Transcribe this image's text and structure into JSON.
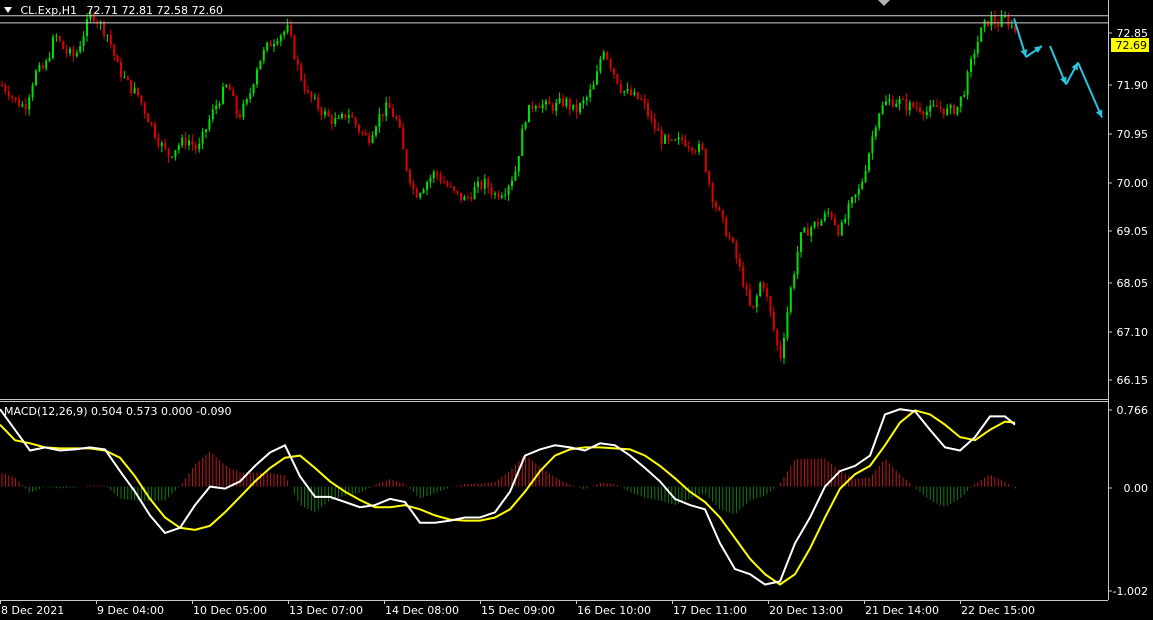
{
  "header": {
    "symbol": "CL.Exp,H1",
    "ohlc": "72.71 72.81 72.58 72.60"
  },
  "macd_header": "MACD(12,26,9) 0.504 0.573 0.000 -0.090",
  "price_badge": "72.69",
  "colors": {
    "background": "#000000",
    "bull_candle": "#00e000",
    "bear_candle": "#e00000",
    "macd_line": "#ffffff",
    "signal_line": "#ffff00",
    "forecast_arrows": "#29c6e0",
    "badge": "#ffff00"
  },
  "chart_data": [
    {
      "type": "candlestick",
      "title": "CL.Exp,H1",
      "ylim": [
        65.9,
        73.1
      ],
      "y_ticks": [
        "72.85",
        "72.69",
        "71.90",
        "70.95",
        "70.00",
        "69.05",
        "68.05",
        "67.10",
        "66.15"
      ],
      "x_ticks": [
        "8 Dec 2021",
        "9 Dec 04:00",
        "10 Dec 05:00",
        "13 Dec 07:00",
        "14 Dec 08:00",
        "15 Dec 09:00",
        "16 Dec 10:00",
        "17 Dec 11:00",
        "20 Dec 13:00",
        "21 Dec 14:00",
        "22 Dec 15:00"
      ],
      "horizontal_levels": [
        72.85,
        72.72
      ],
      "current_price": 72.69,
      "close_path": [
        [
          0,
          71.6
        ],
        [
          8,
          71.5
        ],
        [
          15,
          71.3
        ],
        [
          25,
          71.2
        ],
        [
          35,
          71.8
        ],
        [
          45,
          71.9
        ],
        [
          55,
          72.5
        ],
        [
          65,
          72.2
        ],
        [
          75,
          72.1
        ],
        [
          85,
          72.6
        ],
        [
          92,
          72.9
        ],
        [
          100,
          72.7
        ],
        [
          108,
          72.5
        ],
        [
          118,
          71.9
        ],
        [
          128,
          71.6
        ],
        [
          138,
          71.4
        ],
        [
          148,
          71.0
        ],
        [
          158,
          70.6
        ],
        [
          168,
          70.3
        ],
        [
          178,
          70.5
        ],
        [
          188,
          70.6
        ],
        [
          198,
          70.4
        ],
        [
          208,
          70.9
        ],
        [
          218,
          71.3
        ],
        [
          228,
          71.6
        ],
        [
          238,
          71.0
        ],
        [
          248,
          71.3
        ],
        [
          258,
          72.0
        ],
        [
          268,
          72.3
        ],
        [
          278,
          72.5
        ],
        [
          288,
          72.6
        ],
        [
          298,
          71.9
        ],
        [
          308,
          71.4
        ],
        [
          318,
          71.2
        ],
        [
          328,
          71.0
        ],
        [
          338,
          70.9
        ],
        [
          348,
          71.1
        ],
        [
          358,
          70.8
        ],
        [
          368,
          70.6
        ],
        [
          378,
          71.0
        ],
        [
          388,
          71.2
        ],
        [
          398,
          70.9
        ],
        [
          405,
          70.2
        ],
        [
          415,
          69.6
        ],
        [
          425,
          69.8
        ],
        [
          435,
          70.0
        ],
        [
          445,
          69.8
        ],
        [
          455,
          69.6
        ],
        [
          465,
          69.5
        ],
        [
          475,
          69.7
        ],
        [
          485,
          69.8
        ],
        [
          495,
          69.6
        ],
        [
          505,
          69.7
        ],
        [
          515,
          70.0
        ],
        [
          525,
          71.0
        ],
        [
          535,
          71.3
        ],
        [
          545,
          71.2
        ],
        [
          555,
          71.2
        ],
        [
          565,
          71.3
        ],
        [
          575,
          71.1
        ],
        [
          585,
          71.3
        ],
        [
          595,
          71.6
        ],
        [
          603,
          72.3
        ],
        [
          612,
          71.9
        ],
        [
          622,
          71.5
        ],
        [
          632,
          71.4
        ],
        [
          642,
          71.3
        ],
        [
          652,
          70.9
        ],
        [
          662,
          70.6
        ],
        [
          672,
          70.5
        ],
        [
          682,
          70.6
        ],
        [
          692,
          70.5
        ],
        [
          702,
          70.4
        ],
        [
          712,
          69.6
        ],
        [
          722,
          69.1
        ],
        [
          732,
          68.7
        ],
        [
          742,
          68.1
        ],
        [
          752,
          67.4
        ],
        [
          762,
          68.1
        ],
        [
          772,
          67.3
        ],
        [
          780,
          66.6
        ],
        [
          790,
          67.8
        ],
        [
          800,
          68.8
        ],
        [
          810,
          69.0
        ],
        [
          820,
          69.1
        ],
        [
          830,
          69.3
        ],
        [
          840,
          68.9
        ],
        [
          850,
          69.4
        ],
        [
          860,
          69.7
        ],
        [
          868,
          70.3
        ],
        [
          878,
          71.1
        ],
        [
          888,
          71.3
        ],
        [
          898,
          71.3
        ],
        [
          908,
          71.2
        ],
        [
          918,
          71.2
        ],
        [
          928,
          71.1
        ],
        [
          938,
          71.2
        ],
        [
          948,
          71.1
        ],
        [
          958,
          71.2
        ],
        [
          966,
          71.6
        ],
        [
          974,
          72.2
        ],
        [
          982,
          72.6
        ],
        [
          990,
          72.8
        ],
        [
          998,
          72.7
        ],
        [
          1006,
          72.8
        ],
        [
          1014,
          72.6
        ]
      ],
      "forecast_arrows": [
        [
          1014,
          72.8,
          1026,
          72.1
        ],
        [
          1026,
          72.1,
          1042,
          72.3
        ],
        [
          1050,
          72.3,
          1066,
          71.6
        ],
        [
          1066,
          71.6,
          1078,
          72.0
        ],
        [
          1078,
          72.0,
          1102,
          71.0
        ]
      ]
    },
    {
      "type": "line",
      "title": "MACD(12,26,9)",
      "ylim": [
        -1.1,
        0.82
      ],
      "y_ticks": [
        "0.766",
        "0.00",
        "-1.002"
      ],
      "series": [
        {
          "name": "MACD",
          "points": [
            [
              0,
              0.75
            ],
            [
              15,
              0.55
            ],
            [
              30,
              0.35
            ],
            [
              45,
              0.38
            ],
            [
              60,
              0.35
            ],
            [
              75,
              0.36
            ],
            [
              90,
              0.38
            ],
            [
              105,
              0.36
            ],
            [
              120,
              0.15
            ],
            [
              135,
              -0.05
            ],
            [
              150,
              -0.28
            ],
            [
              165,
              -0.45
            ],
            [
              180,
              -0.4
            ],
            [
              195,
              -0.18
            ],
            [
              210,
              0.0
            ],
            [
              225,
              -0.02
            ],
            [
              240,
              0.05
            ],
            [
              255,
              0.2
            ],
            [
              270,
              0.33
            ],
            [
              285,
              0.4
            ],
            [
              300,
              0.1
            ],
            [
              315,
              -0.1
            ],
            [
              330,
              -0.1
            ],
            [
              345,
              -0.15
            ],
            [
              360,
              -0.2
            ],
            [
              375,
              -0.18
            ],
            [
              390,
              -0.12
            ],
            [
              405,
              -0.15
            ],
            [
              420,
              -0.35
            ],
            [
              435,
              -0.35
            ],
            [
              450,
              -0.33
            ],
            [
              465,
              -0.3
            ],
            [
              480,
              -0.3
            ],
            [
              495,
              -0.25
            ],
            [
              510,
              -0.05
            ],
            [
              525,
              0.3
            ],
            [
              540,
              0.36
            ],
            [
              555,
              0.4
            ],
            [
              570,
              0.38
            ],
            [
              585,
              0.35
            ],
            [
              600,
              0.42
            ],
            [
              615,
              0.4
            ],
            [
              630,
              0.3
            ],
            [
              645,
              0.18
            ],
            [
              660,
              0.05
            ],
            [
              675,
              -0.12
            ],
            [
              690,
              -0.18
            ],
            [
              705,
              -0.22
            ],
            [
              720,
              -0.55
            ],
            [
              735,
              -0.8
            ],
            [
              750,
              -0.85
            ],
            [
              765,
              -0.95
            ],
            [
              780,
              -0.92
            ],
            [
              795,
              -0.55
            ],
            [
              810,
              -0.3
            ],
            [
              825,
              0.0
            ],
            [
              840,
              0.15
            ],
            [
              855,
              0.2
            ],
            [
              870,
              0.3
            ],
            [
              885,
              0.7
            ],
            [
              900,
              0.75
            ],
            [
              915,
              0.73
            ],
            [
              930,
              0.55
            ],
            [
              945,
              0.38
            ],
            [
              960,
              0.35
            ],
            [
              975,
              0.48
            ],
            [
              990,
              0.68
            ],
            [
              1005,
              0.68
            ],
            [
              1015,
              0.6
            ]
          ]
        },
        {
          "name": "Signal",
          "points": [
            [
              0,
              0.6
            ],
            [
              15,
              0.45
            ],
            [
              30,
              0.42
            ],
            [
              45,
              0.38
            ],
            [
              60,
              0.37
            ],
            [
              75,
              0.37
            ],
            [
              90,
              0.37
            ],
            [
              105,
              0.35
            ],
            [
              120,
              0.28
            ],
            [
              135,
              0.1
            ],
            [
              150,
              -0.12
            ],
            [
              165,
              -0.3
            ],
            [
              180,
              -0.4
            ],
            [
              195,
              -0.42
            ],
            [
              210,
              -0.38
            ],
            [
              225,
              -0.25
            ],
            [
              240,
              -0.1
            ],
            [
              255,
              0.05
            ],
            [
              270,
              0.18
            ],
            [
              285,
              0.28
            ],
            [
              300,
              0.3
            ],
            [
              315,
              0.18
            ],
            [
              330,
              0.05
            ],
            [
              345,
              -0.05
            ],
            [
              360,
              -0.13
            ],
            [
              375,
              -0.2
            ],
            [
              390,
              -0.2
            ],
            [
              405,
              -0.18
            ],
            [
              420,
              -0.22
            ],
            [
              435,
              -0.28
            ],
            [
              450,
              -0.32
            ],
            [
              465,
              -0.33
            ],
            [
              480,
              -0.33
            ],
            [
              495,
              -0.3
            ],
            [
              510,
              -0.22
            ],
            [
              525,
              -0.05
            ],
            [
              540,
              0.15
            ],
            [
              555,
              0.3
            ],
            [
              570,
              0.36
            ],
            [
              585,
              0.38
            ],
            [
              600,
              0.38
            ],
            [
              615,
              0.37
            ],
            [
              630,
              0.36
            ],
            [
              645,
              0.3
            ],
            [
              660,
              0.2
            ],
            [
              675,
              0.08
            ],
            [
              690,
              -0.05
            ],
            [
              705,
              -0.15
            ],
            [
              720,
              -0.3
            ],
            [
              735,
              -0.5
            ],
            [
              750,
              -0.7
            ],
            [
              765,
              -0.85
            ],
            [
              780,
              -0.95
            ],
            [
              795,
              -0.85
            ],
            [
              810,
              -0.6
            ],
            [
              825,
              -0.3
            ],
            [
              840,
              -0.02
            ],
            [
              855,
              0.12
            ],
            [
              870,
              0.2
            ],
            [
              885,
              0.4
            ],
            [
              900,
              0.62
            ],
            [
              915,
              0.74
            ],
            [
              930,
              0.7
            ],
            [
              945,
              0.6
            ],
            [
              960,
              0.48
            ],
            [
              975,
              0.45
            ],
            [
              990,
              0.55
            ],
            [
              1005,
              0.63
            ],
            [
              1015,
              0.62
            ]
          ]
        }
      ]
    }
  ]
}
